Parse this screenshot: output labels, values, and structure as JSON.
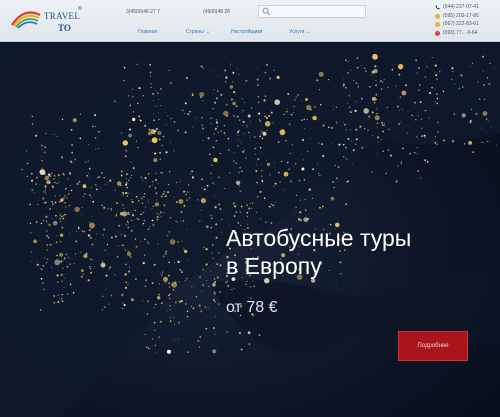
{
  "header": {
    "logo": {
      "line1": "TRAVEL",
      "line2": "TO",
      "reg": "®"
    },
    "phone_1": "3(4500)48 27 7",
    "phone_2": "(4500)48 28",
    "search": {
      "placeholder": "",
      "icon": "search-icon"
    },
    "nav": [
      {
        "label": "Главная"
      },
      {
        "label": "Страны",
        "has_dropdown": true
      },
      {
        "label": "Настройщики"
      },
      {
        "label": "Услуги",
        "has_dropdown": true
      }
    ],
    "contacts": [
      {
        "text": "(044) 237-07-41",
        "icon": "phone-icon",
        "color": "#2a2a2a"
      },
      {
        "text": "(095) 203-17-86",
        "icon": "operator-icon",
        "color": "#e8b23a"
      },
      {
        "text": "(067) 222-83-61",
        "icon": "operator-icon",
        "color": "#e8b23a"
      },
      {
        "text": "(093) 77...-9-64",
        "icon": "operator-icon",
        "color": "#d8433a"
      }
    ]
  },
  "hero": {
    "title_line1": "Автобусные туры",
    "title_line2": "в Европу",
    "price": "от 78 €",
    "button_label": "Подробнее",
    "button_color": "#a8161c"
  }
}
